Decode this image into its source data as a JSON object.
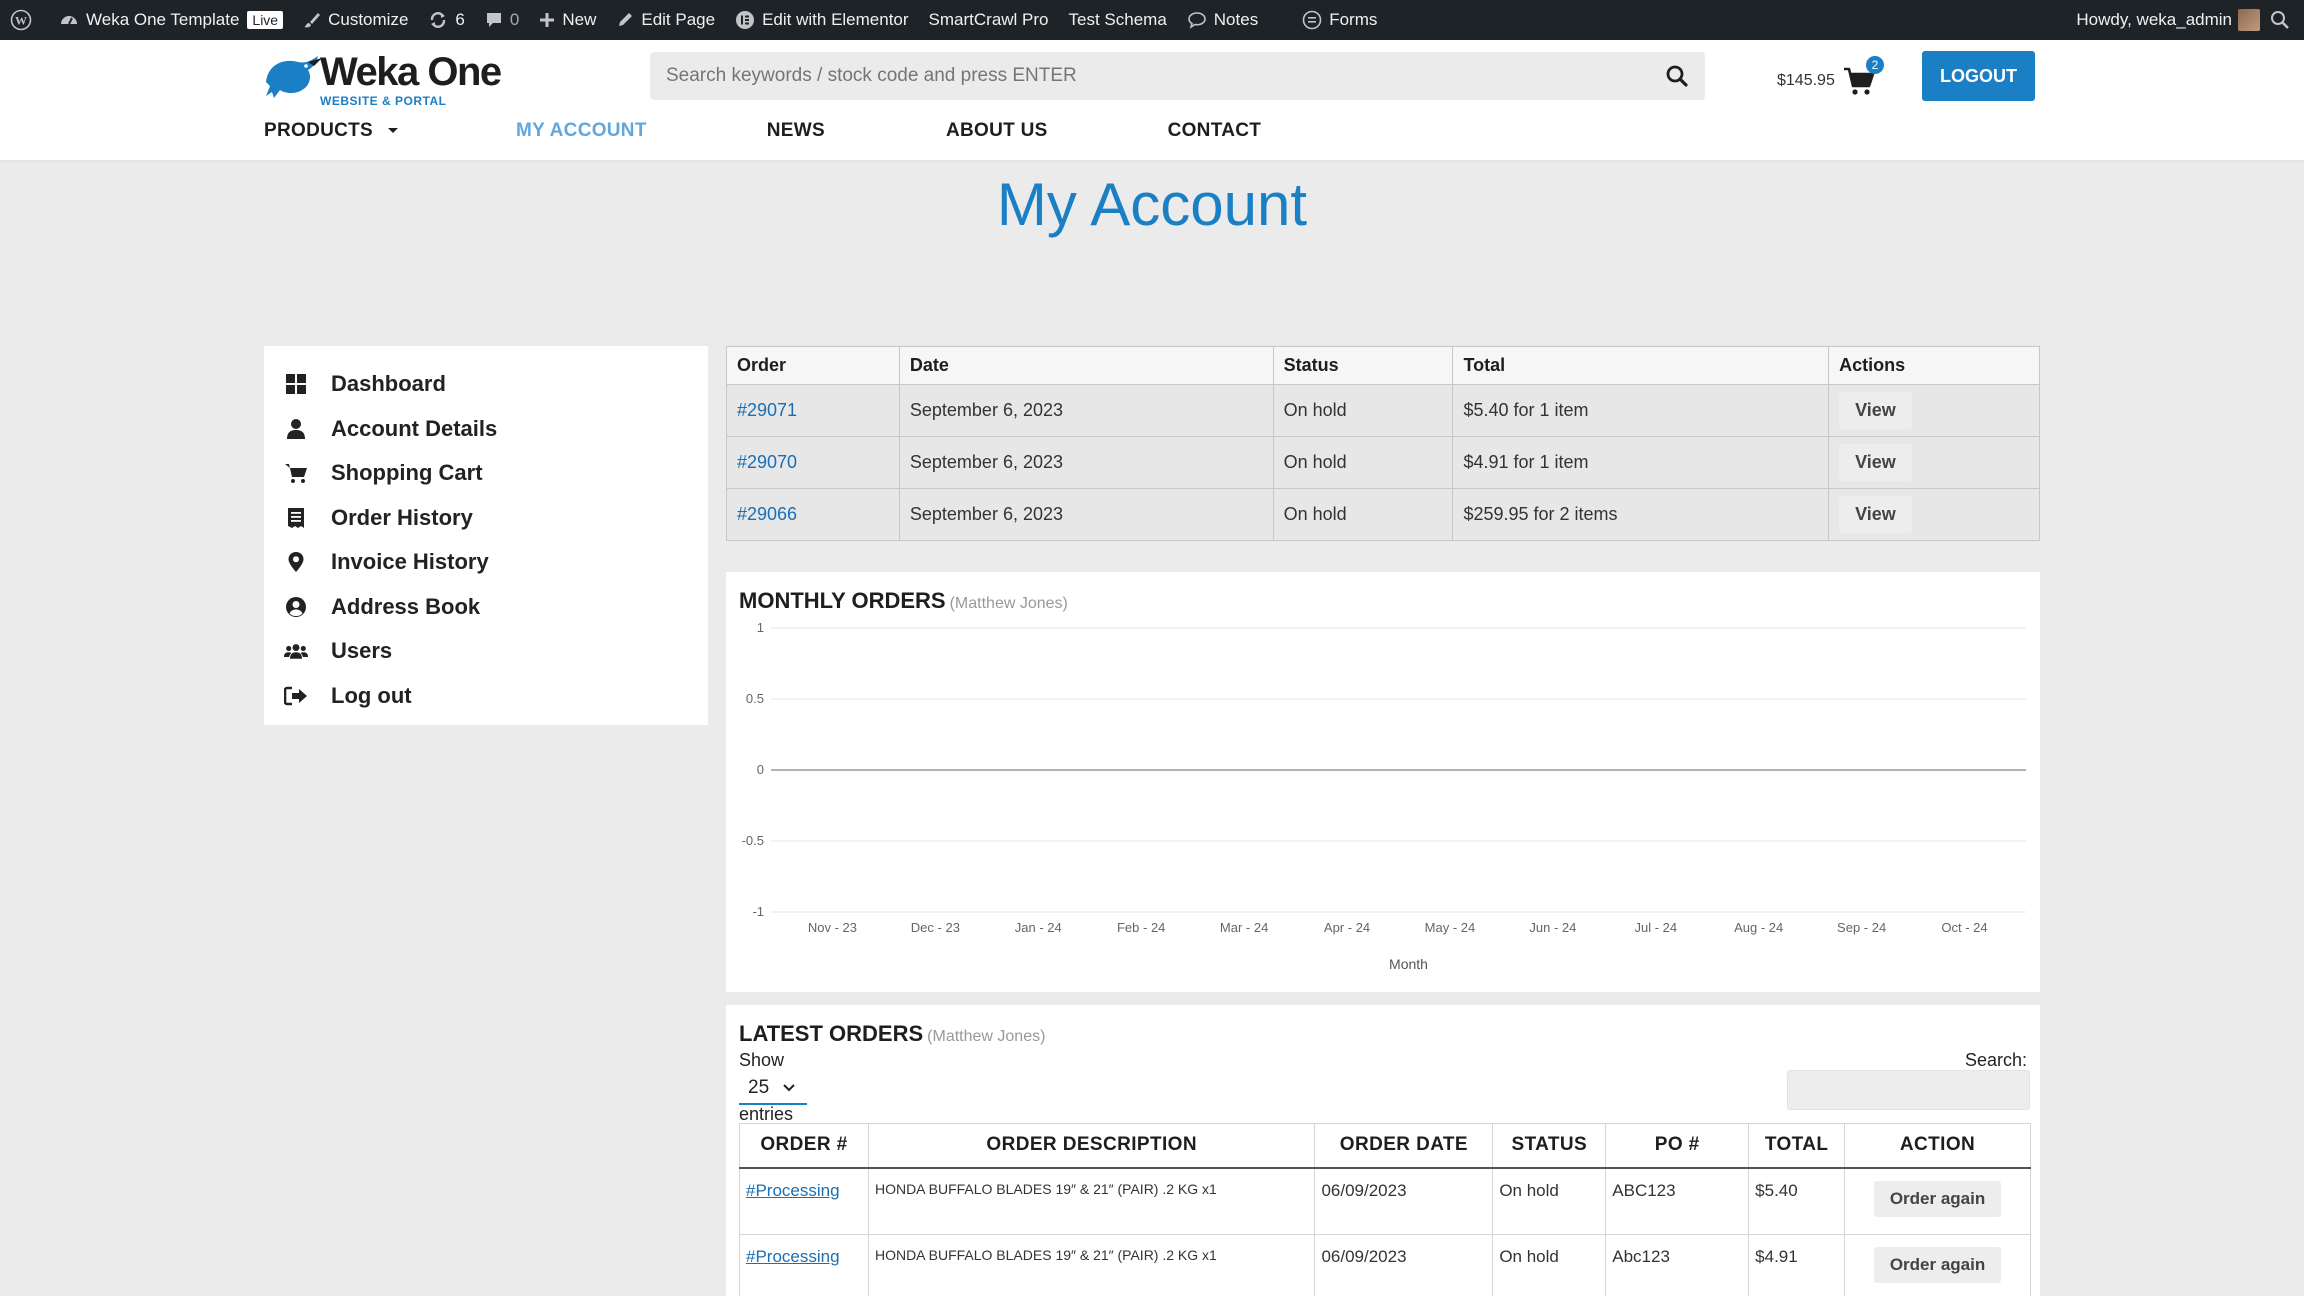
{
  "adminbar": {
    "site_name": "Weka One Template",
    "live_badge": "Live",
    "customize": "Customize",
    "updates_count": "6",
    "comments_count": "0",
    "new": "New",
    "edit_page": "Edit Page",
    "edit_elementor": "Edit with Elementor",
    "smartcrawl": "SmartCrawl Pro",
    "test_schema": "Test Schema",
    "notes": "Notes",
    "forms": "Forms",
    "howdy": "Howdy, weka_admin"
  },
  "header": {
    "logo_main": "Weka One",
    "logo_sub": "WEBSITE & PORTAL",
    "search_placeholder": "Search keywords / stock code and press ENTER",
    "cart_total": "$145.95",
    "cart_count": "2",
    "logout": "LOGOUT",
    "nav": [
      "PRODUCTS",
      "MY ACCOUNT",
      "NEWS",
      "ABOUT US",
      "CONTACT"
    ]
  },
  "page_title": "My Account",
  "sidebar": {
    "items": [
      {
        "label": "Dashboard",
        "icon": "dashboard-icon"
      },
      {
        "label": "Account Details",
        "icon": "user-icon"
      },
      {
        "label": "Shopping Cart",
        "icon": "cart-icon"
      },
      {
        "label": "Order History",
        "icon": "receipt-icon"
      },
      {
        "label": "Invoice History",
        "icon": "map-pin-icon"
      },
      {
        "label": "Address Book",
        "icon": "user-circle-icon"
      },
      {
        "label": "Users",
        "icon": "users-icon"
      },
      {
        "label": "Log out",
        "icon": "sign-out-icon"
      }
    ]
  },
  "orders": {
    "headers": [
      "Order",
      "Date",
      "Status",
      "Total",
      "Actions"
    ],
    "rows": [
      {
        "order": "#29071",
        "date": "September 6, 2023",
        "status": "On hold",
        "total": "$5.40 for 1 item",
        "action": "View"
      },
      {
        "order": "#29070",
        "date": "September 6, 2023",
        "status": "On hold",
        "total": "$4.91 for 1 item",
        "action": "View"
      },
      {
        "order": "#29066",
        "date": "September 6, 2023",
        "status": "On hold",
        "total": "$259.95 for 2 items",
        "action": "View"
      }
    ]
  },
  "monthly": {
    "title": "MONTHLY ORDERS",
    "subtitle": "(Matthew Jones)"
  },
  "chart_data": {
    "type": "line",
    "title": "MONTHLY ORDERS",
    "subtitle": "(Matthew Jones)",
    "xlabel": "Month",
    "ylabel": "",
    "categories": [
      "Nov - 23",
      "Dec - 23",
      "Jan - 24",
      "Feb - 24",
      "Mar - 24",
      "Apr - 24",
      "May - 24",
      "Jun - 24",
      "Jul - 24",
      "Aug - 24",
      "Sep - 24",
      "Oct - 24"
    ],
    "series": [
      {
        "values": [
          0,
          0,
          0,
          0,
          0,
          0,
          0,
          0,
          0,
          0,
          0,
          0
        ]
      }
    ],
    "yticks": [
      "1",
      "0.5",
      "0",
      "-0.5",
      "-1"
    ],
    "ylim": [
      -1,
      1
    ],
    "grid": true
  },
  "latest": {
    "title": "LATEST ORDERS",
    "subtitle": "(Matthew Jones)",
    "show_label": "Show",
    "page_size": "25",
    "entries_label": "entries",
    "search_label": "Search:",
    "headers": [
      "ORDER #",
      "ORDER DESCRIPTION",
      "ORDER DATE",
      "STATUS",
      "PO #",
      "TOTAL",
      "ACTION"
    ],
    "rows": [
      {
        "order": "#Processing",
        "desc": "HONDA BUFFALO BLADES 19″ & 21″ (PAIR) .2 KG x1",
        "date": "06/09/2023",
        "status": "On hold",
        "po": "ABC123",
        "total": "$5.40",
        "action": "Order again"
      },
      {
        "order": "#Processing",
        "desc": "HONDA BUFFALO BLADES 19″ & 21″ (PAIR) .2 KG x1",
        "date": "06/09/2023",
        "status": "On hold",
        "po": "Abc123",
        "total": "$4.91",
        "action": "Order again"
      }
    ]
  }
}
